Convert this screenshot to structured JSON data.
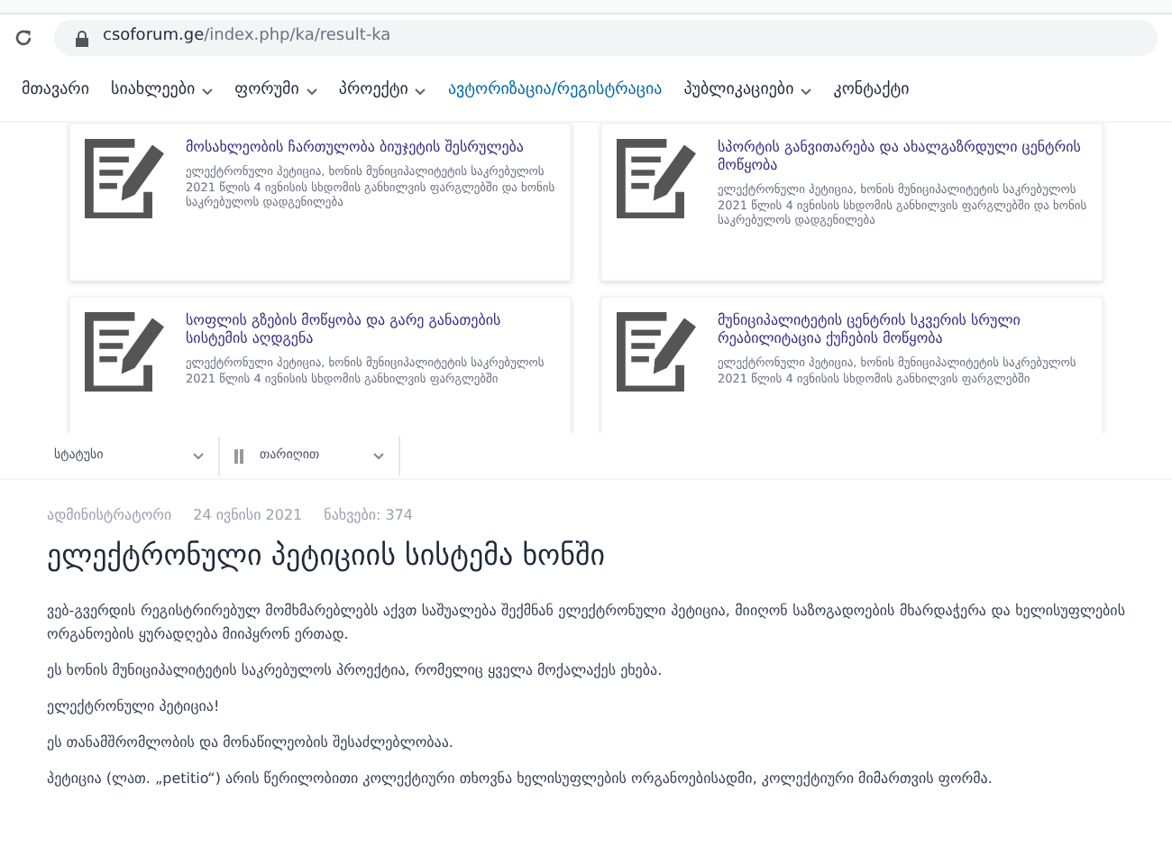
{
  "browser": {
    "url_host": "csoforum.ge",
    "url_path": "/index.php/ka/result-ka"
  },
  "nav": [
    {
      "label": "მთავარი",
      "dropdown": false,
      "selected": false
    },
    {
      "label": "სიახლეები",
      "dropdown": true,
      "selected": false
    },
    {
      "label": "ფორუმი",
      "dropdown": true,
      "selected": false
    },
    {
      "label": "პროექტი",
      "dropdown": true,
      "selected": false
    },
    {
      "label": "ავტორიზაცია/რეგისტრაცია",
      "dropdown": false,
      "selected": true
    },
    {
      "label": "პუბლიკაციები",
      "dropdown": true,
      "selected": false
    },
    {
      "label": "კონტაქტი",
      "dropdown": false,
      "selected": false
    }
  ],
  "cards": [
    {
      "title": "მოსახლეობის ჩართულობა ბიუჯეტის შესრულება",
      "excerpt": "ელექტრონული პეტიცია, ხონის მუნიციპალიტეტის საკრებულოს 2021 წლის 4 ივნისის სხდომის განხილვის ფარგლებში და ხონის საკრებულოს დადგენილება"
    },
    {
      "title": "სპორტის განვითარება და ახალგაზრდული ცენტრის მოწყობა",
      "excerpt": "ელექტრონული პეტიცია, ხონის მუნიციპალიტეტის საკრებულოს 2021 წლის 4 ივნისის სხდომის განხილვის ფარგლებში და ხონის საკრებულოს დადგენილება"
    },
    {
      "title": "სოფლის გზების მოწყობა და გარე განათების სისტემის აღდგენა",
      "excerpt": "ელექტრონული პეტიცია, ხონის მუნიციპალიტეტის საკრებულოს 2021 წლის 4 ივნისის სხდომის განხილვის ფარგლებში"
    },
    {
      "title": "მუნიციპალიტეტის ცენტრის სკვერის სრული რეაბილიტაცია ქუჩების მოწყობა",
      "excerpt": "ელექტრონული პეტიცია, ხონის მუნიციპალიტეტის საკრებულოს 2021 წლის 4 ივნისის სხდომის განხილვის ფარგლებში"
    }
  ],
  "filters": [
    {
      "label": "სტატუსი",
      "icon": false
    },
    {
      "label": "თარიღით",
      "icon": true
    }
  ],
  "article": {
    "author": "ადმინისტრატორი",
    "date": "24 ივნისი 2021",
    "views": "ნახვები: 374",
    "title": "ელექტრონული პეტიციის სისტემა ხონში",
    "paragraphs": [
      "ვებ-გვერდის რეგისტრირებულ მომხმარებლებს აქვთ საშუალება შექმნან ელექტრონული პეტიცია, მიიღონ საზოგადოების მხარდაჭერა და ხელისუფლების ორგანოების ყურადღება მიიპყრონ ერთად.",
      "ეს ხონის მუნიციპალიტეტის საკრებულოს პროექტია, რომელიც ყველა მოქალაქეს ეხება.",
      "ელექტრონული პეტიცია!",
      "ეს თანამშრომლობის და მონაწილეობის შესაძლებლობაა.",
      "პეტიცია (ლათ. „petitio“) არის წერილობითი კოლექტიური თხოვნა ხელისუფლების ორგანოებისადმი, კოლექტიური მიმართვის ფორმა."
    ]
  }
}
